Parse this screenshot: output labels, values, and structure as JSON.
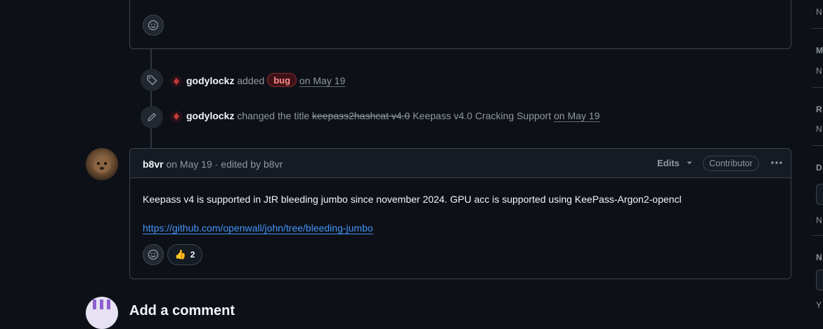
{
  "timeline": {
    "event1": {
      "user": "godylockz",
      "action": "added",
      "label": "bug",
      "date": "on May 19"
    },
    "event2": {
      "user": "godylockz",
      "action": "changed the title",
      "old_title": "keepass2hashcat v4.0",
      "new_title": "Keepass v4.0 Cracking Support",
      "date": "on May 19"
    }
  },
  "comment": {
    "author": "b8vr",
    "meta": "on May 19 · edited by b8vr",
    "edits_label": "Edits",
    "role_badge": "Contributor",
    "body": "Keepass v4 is supported in JtR bleeding jumbo since november 2024. GPU acc is supported using KeePass-Argon2-opencl",
    "link": "https://github.com/openwall/john/tree/bleeding-jumbo",
    "reaction": {
      "emoji": "👍",
      "count": "2"
    }
  },
  "add_comment": {
    "title": "Add a comment"
  },
  "sidebar": {
    "letters": [
      "N",
      "M",
      "N",
      "R",
      "N",
      "D",
      "N",
      "N",
      "Y"
    ]
  }
}
